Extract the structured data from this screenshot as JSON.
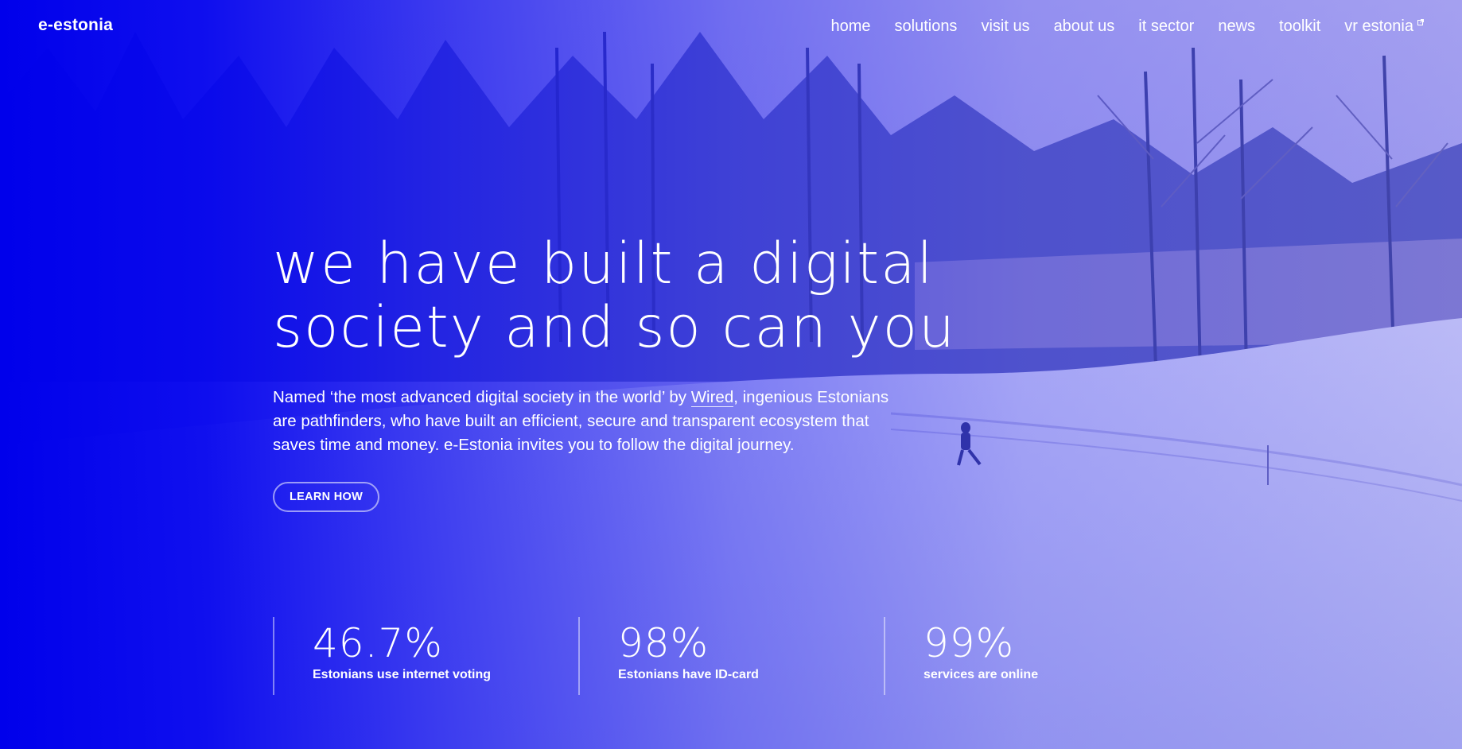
{
  "header": {
    "logo": "e-estonia",
    "nav": [
      {
        "label": "home"
      },
      {
        "label": "solutions"
      },
      {
        "label": "visit us"
      },
      {
        "label": "about us"
      },
      {
        "label": "it sector"
      },
      {
        "label": "news"
      },
      {
        "label": "toolkit"
      },
      {
        "label": "vr estonia",
        "icon": "external-link-icon"
      }
    ]
  },
  "hero": {
    "headline_line1": "we have built a digital",
    "headline_line2": "society and so can you",
    "intro_before": "Named ‘the most advanced digital society in the world’ by ",
    "intro_link": "Wired",
    "intro_after": ", ingenious Estonians are pathfinders, who have built an efficient, secure and transparent ecosystem that saves time and money. e-Estonia invites you to follow the digital journey.",
    "cta": "LEARN HOW"
  },
  "stats": [
    {
      "value": "46.7%",
      "label": "Estonians use internet voting"
    },
    {
      "value": "98%",
      "label": "Estonians have ID-card"
    },
    {
      "value": "99%",
      "label": "services are online"
    }
  ],
  "colors": {
    "brand_blue": "#0000ee",
    "text": "#ffffff"
  }
}
